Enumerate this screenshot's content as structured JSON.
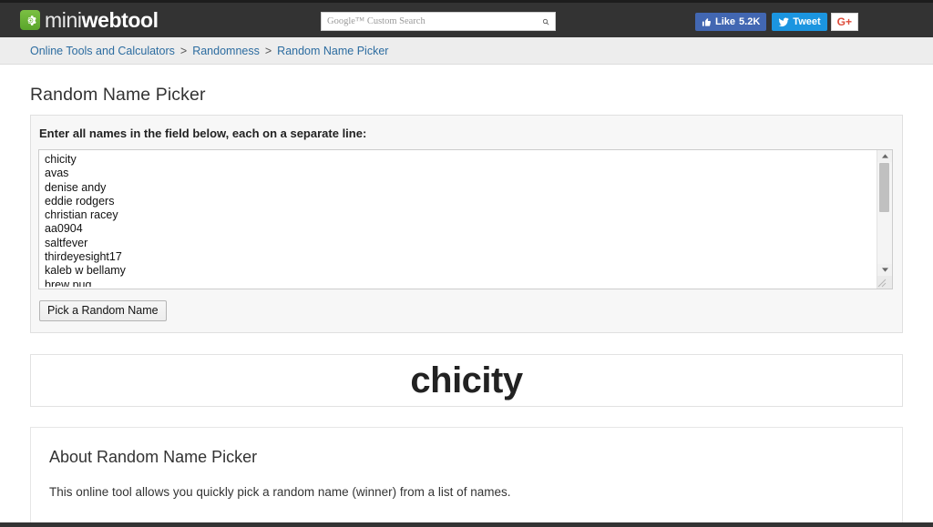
{
  "header": {
    "logo_mini": "mini",
    "logo_webtool": "webtool",
    "logo_icon": "gear-icon",
    "search": {
      "placeholder": "Google™ Custom Search",
      "value": "",
      "icon": "search-icon"
    },
    "social": {
      "like_label": "Like",
      "like_count": "5.2K",
      "tweet_label": "Tweet",
      "gplus_label": "G+"
    }
  },
  "breadcrumb": {
    "items": [
      {
        "label": "Online Tools and Calculators"
      },
      {
        "label": "Randomness"
      },
      {
        "label": "Random Name Picker"
      }
    ],
    "separator": ">"
  },
  "main": {
    "page_title": "Random Name Picker",
    "form": {
      "label": "Enter all names in the field below, each on a separate line:",
      "names_value": "chicity\navas\ndenise andy\neddie rodgers\nchristian racey\naa0904\nsaltfever\nthirdeyesight17\nkaleb w bellamy\nbrew pug",
      "names_list": [
        "chicity",
        "avas",
        "denise andy",
        "eddie rodgers",
        "christian racey",
        "aa0904",
        "saltfever",
        "thirdeyesight17",
        "kaleb w bellamy",
        "brew pug"
      ],
      "submit_label": "Pick a Random Name"
    },
    "result": {
      "winner": "chicity"
    },
    "about": {
      "title": "About Random Name Picker",
      "text": "This online tool allows you quickly pick a random name (winner) from a list of names."
    }
  },
  "colors": {
    "header_bg": "#333333",
    "brand_green": "#7bc043",
    "link_blue": "#2c6ca0",
    "facebook_blue": "#4267b2",
    "twitter_blue": "#1b95e0",
    "gplus_red": "#dd4b39"
  }
}
